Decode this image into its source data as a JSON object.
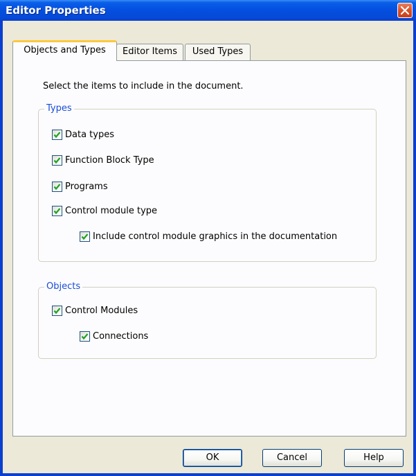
{
  "window": {
    "title": "Editor Properties"
  },
  "tabs": [
    {
      "label": "Objects and Types",
      "active": true
    },
    {
      "label": "Editor Items",
      "active": false
    },
    {
      "label": "Used Types",
      "active": false
    }
  ],
  "instructions": "Select the items to include in the document.",
  "groups": {
    "types": {
      "legend": "Types",
      "items": [
        {
          "label": "Data types",
          "checked": true
        },
        {
          "label": "Function Block Type",
          "checked": true
        },
        {
          "label": "Programs",
          "checked": true
        },
        {
          "label": "Control module type",
          "checked": true
        },
        {
          "label": "Include control module graphics in the documentation",
          "checked": true
        }
      ]
    },
    "objects": {
      "legend": "Objects",
      "items": [
        {
          "label": "Control Modules",
          "checked": true
        },
        {
          "label": "Connections",
          "checked": true
        }
      ]
    }
  },
  "buttons": {
    "ok": "OK",
    "cancel": "Cancel",
    "help": "Help"
  },
  "colors": {
    "title_bar": "#0550e0",
    "legend_text": "#1a4dd6",
    "check_mark": "#21a121",
    "close_button": "#d8512a",
    "active_tab_highlight": "#ffc83c"
  },
  "icons": {
    "close": "close-icon",
    "check": "check-icon"
  }
}
